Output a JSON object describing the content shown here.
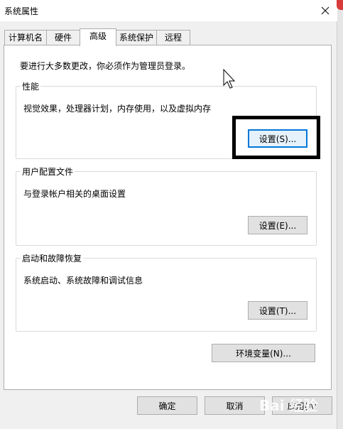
{
  "window": {
    "title": "系统属性"
  },
  "tabs": [
    {
      "label": "计算机名",
      "active": false
    },
    {
      "label": "硬件",
      "active": false
    },
    {
      "label": "高级",
      "active": true
    },
    {
      "label": "系统保护",
      "active": false
    },
    {
      "label": "远程",
      "active": false
    }
  ],
  "advanced": {
    "admin_note": "要进行大多数更改，你必须作为管理员登录。",
    "performance": {
      "title": "性能",
      "description": "视觉效果，处理器计划，内存使用，以及虚拟内存",
      "button": "设置(S)..."
    },
    "user_profiles": {
      "title": "用户配置文件",
      "description": "与登录帐户相关的桌面设置",
      "button": "设置(E)..."
    },
    "startup_recovery": {
      "title": "启动和故障恢复",
      "description": "系统启动、系统故障和调试信息",
      "button": "设置(T)..."
    },
    "env_button": "环境变量(N)..."
  },
  "footer": {
    "ok": "确定",
    "cancel": "取消",
    "apply": "应用(A)"
  },
  "watermark": "Bai 经验",
  "colors": {
    "focus_border": "#0078d7",
    "button_bg": "#e1e1e1",
    "highlight_box": "#000000"
  }
}
